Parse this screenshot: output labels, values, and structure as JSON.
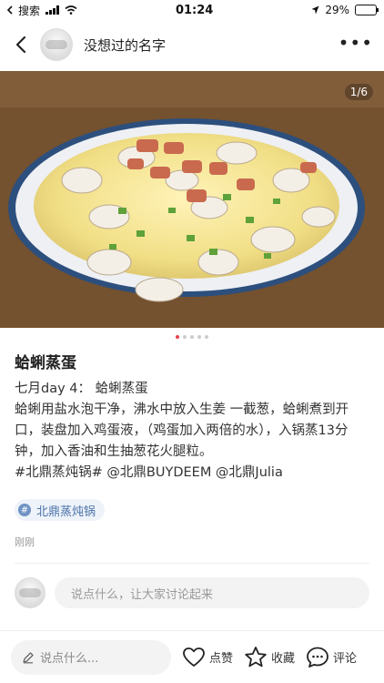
{
  "status_bar": {
    "carrier": "搜索",
    "time": "01:24",
    "battery": "29%",
    "battery_level": 0.29
  },
  "header": {
    "username": "没想过的名字"
  },
  "gallery": {
    "counter": "1/6",
    "dot_count": 5,
    "active_dot": 0
  },
  "post": {
    "title": "蛤蜊蒸蛋",
    "lines": [
      "七月day 4：  蛤蜊蒸蛋",
      "蛤蜊用盐水泡干净，沸水中放入生姜 一截葱，蛤蜊煮到开口，装盘加入鸡蛋液，（鸡蛋加入两倍的水），入锅蒸13分钟，加入香油和生抽葱花火腿粒。",
      "#北鼎蒸炖锅# @北鼎BUYDEEM @北鼎Julia"
    ],
    "tag": "北鼎蒸炖锅",
    "time": "刚刚"
  },
  "comment": {
    "placeholder": "说点什么，让大家讨论起来"
  },
  "bottom_bar": {
    "input_placeholder": "说点什么...",
    "like_label": "点赞",
    "collect_label": "收藏",
    "comment_label": "评论"
  },
  "colors": {
    "accent": "#e9424f",
    "tag_text": "#4a72a8"
  }
}
